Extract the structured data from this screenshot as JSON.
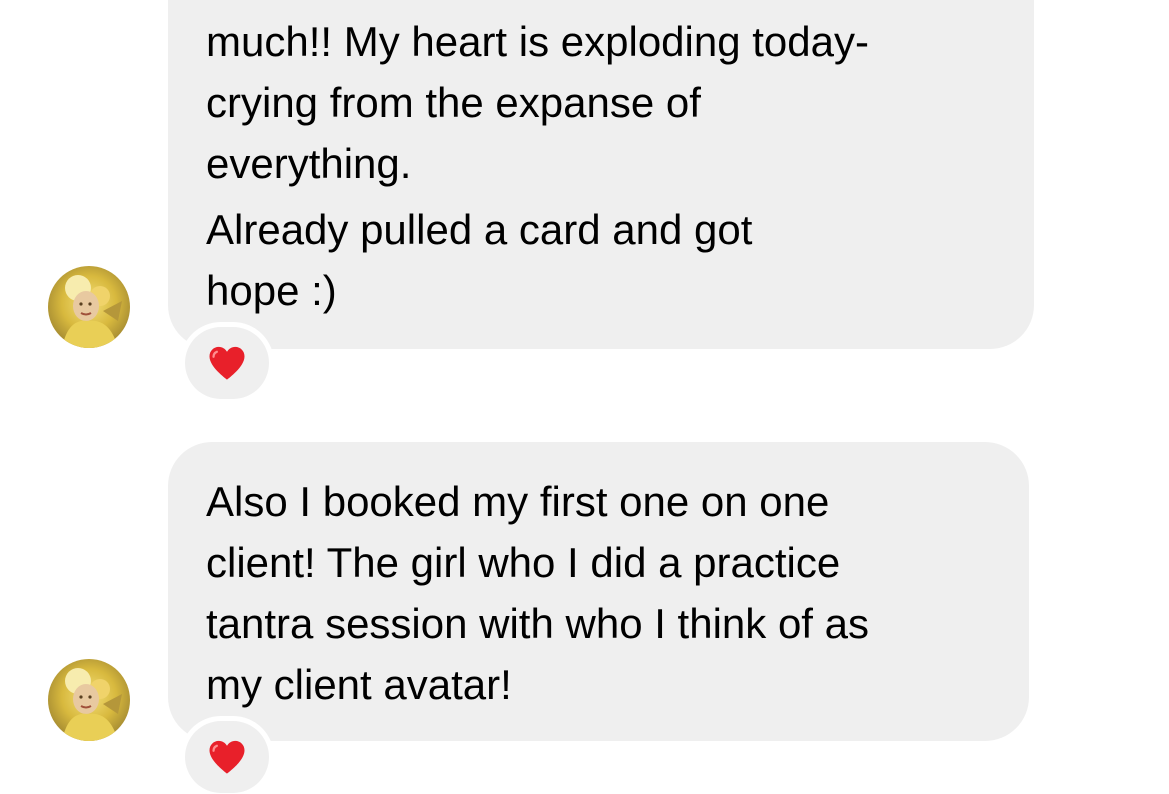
{
  "messages": [
    {
      "paragraphs": [
        [
          "much!! My heart is exploding today-",
          "crying from the expanse of",
          "everything."
        ],
        [
          "Already pulled a card and got",
          "hope :)"
        ]
      ],
      "reaction": "heart"
    },
    {
      "paragraphs": [
        [
          "Also I booked my first one on one",
          "client! The girl who I did a practice",
          "tantra session with who I think of as",
          "my client avatar!"
        ]
      ],
      "reaction": "heart"
    }
  ],
  "colors": {
    "bubble_bg": "#efefef",
    "heart": "#e8202a",
    "background": "#ffffff"
  },
  "icons": {
    "reaction": "red-heart-icon",
    "sender": "avatar"
  }
}
